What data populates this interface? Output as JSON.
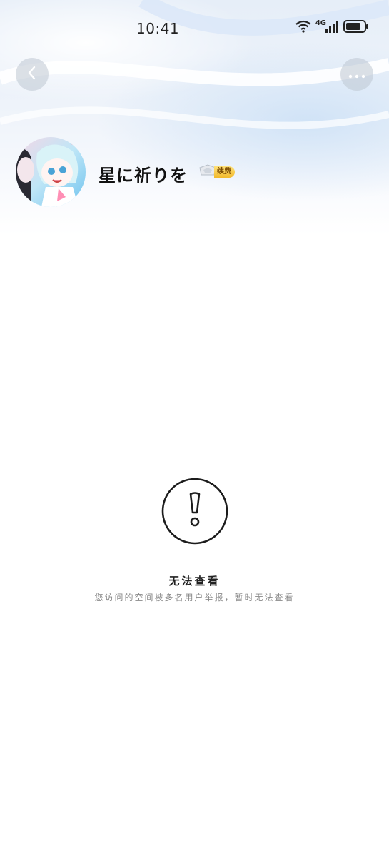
{
  "status_bar": {
    "time": "10:41",
    "network": "4G",
    "icons": [
      "wifi-icon",
      "signal-icon",
      "battery-icon"
    ]
  },
  "nav": {
    "back_icon": "chevron-left-icon",
    "more_icon": "more-dots-icon"
  },
  "profile": {
    "nickname": "星に祈りを",
    "badge_label": "续费",
    "badge_icon": "vip-crown-icon"
  },
  "notice": {
    "icon": "exclamation-circle-icon",
    "title": "无法查看",
    "description": "您访问的空间被多名用户举报，暂时无法查看"
  },
  "colors": {
    "header_tint": "#e6eef8",
    "badge_gold": "#f2b92b",
    "text_primary": "#222222",
    "text_secondary": "#8a8a8a"
  }
}
